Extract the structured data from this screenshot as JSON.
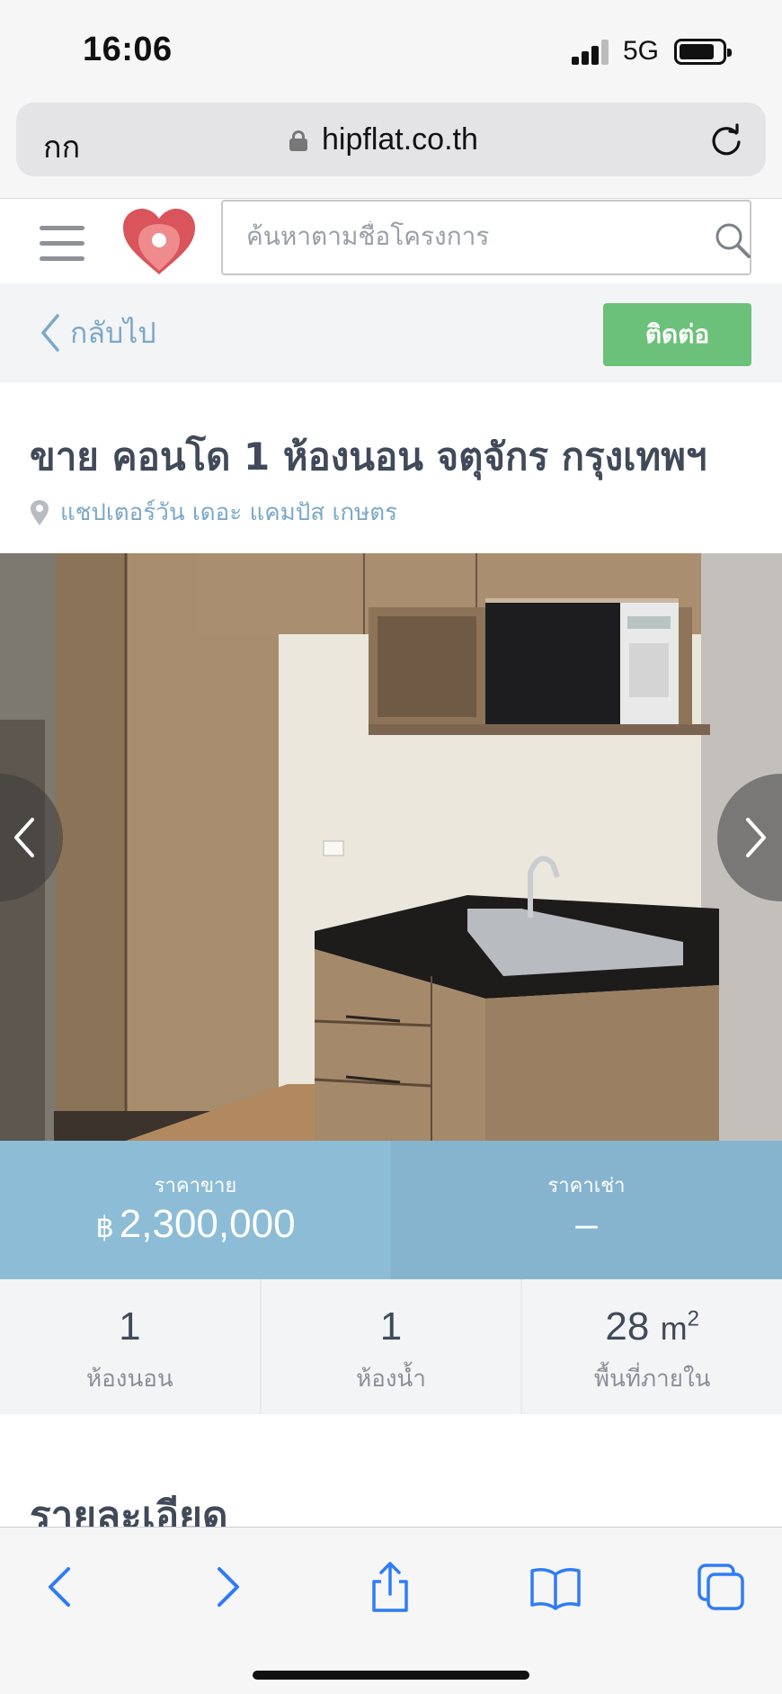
{
  "status": {
    "time": "16:06",
    "network": "5G"
  },
  "browser": {
    "aa_label": "กก",
    "url": "hipflat.co.th"
  },
  "header": {
    "search_placeholder": "ค้นหาตามชื่อโครงการ"
  },
  "actions": {
    "back_label": "กลับไป",
    "contact_label": "ติดต่อ"
  },
  "listing": {
    "title": "ขาย คอนโด 1 ห้องนอน จตุจักร กรุงเทพฯ",
    "location": "แชปเตอร์วัน เดอะ แคมปัส เกษตร",
    "photo_alt": "kitchen-photo"
  },
  "prices": {
    "sale_label": "ราคาขาย",
    "sale_currency": "฿",
    "sale_value": "2,300,000",
    "rent_label": "ราคาเช่า",
    "rent_value": "–"
  },
  "specs": {
    "bedrooms_value": "1",
    "bedrooms_label": "ห้องนอน",
    "bathrooms_value": "1",
    "bathrooms_label": "ห้องน้ำ",
    "area_value": "28",
    "area_unit": "m",
    "area_unit_sup": "2",
    "area_label": "พื้นที่ภายใน"
  },
  "details": {
    "heading": "รายละเอียด"
  },
  "colors": {
    "accent_green": "#6cc17a",
    "link_blue": "#7ba8c8",
    "price_blue": "#8dbcd6",
    "ios_blue": "#2f7cf6"
  }
}
